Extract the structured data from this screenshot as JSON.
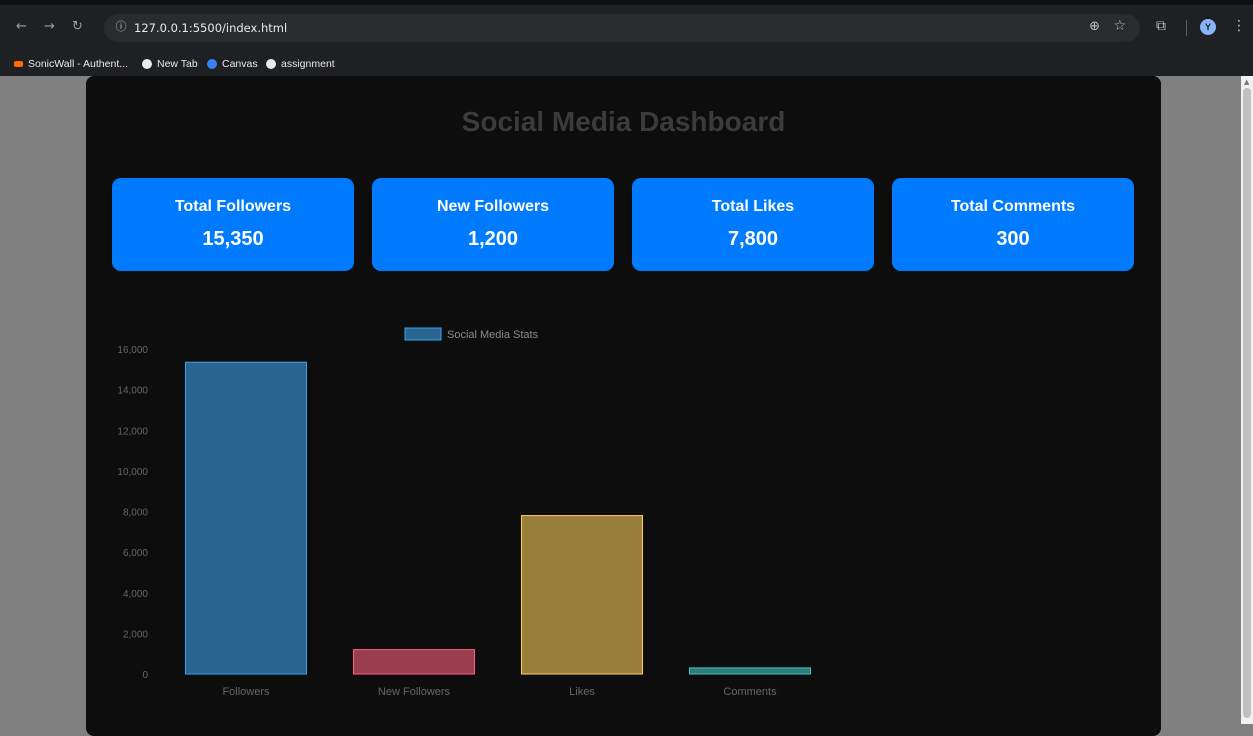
{
  "browser": {
    "url": "127.0.0.1:5500/index.html",
    "avatar_letter": "Y",
    "bookmarks": [
      {
        "label": "SonicWall - Authent...",
        "icon": "sonicwall-icon",
        "color": "#ff6a00"
      },
      {
        "label": "New Tab",
        "icon": "globe-icon",
        "color": "#e8eaed"
      },
      {
        "label": "Canvas",
        "icon": "canvas-icon",
        "color": "#3b82f6"
      },
      {
        "label": "assignment",
        "icon": "wordpress-icon",
        "color": "#e8eaed"
      }
    ]
  },
  "page": {
    "title": "Social Media Dashboard",
    "cards": [
      {
        "label": "Total Followers",
        "value": "15,350"
      },
      {
        "label": "New Followers",
        "value": "1,200"
      },
      {
        "label": "Total Likes",
        "value": "7,800"
      },
      {
        "label": "Total Comments",
        "value": "300"
      }
    ]
  },
  "chart_data": {
    "type": "bar",
    "categories": [
      "Followers",
      "New Followers",
      "Likes",
      "Comments"
    ],
    "series": [
      {
        "name": "Social Media Stats",
        "values": [
          15350,
          1200,
          7800,
          300
        ]
      }
    ],
    "ylim": [
      0,
      16000
    ],
    "yticks": [
      "0",
      "2,000",
      "4,000",
      "6,000",
      "8,000",
      "10,000",
      "12,000",
      "14,000",
      "16,000"
    ],
    "bar_fills": [
      "#2a6592",
      "#9a3d4e",
      "#9a7f3b",
      "#2a7c7a"
    ],
    "bar_strokes": [
      "#36a2eb",
      "#ff6384",
      "#ffce56",
      "#4bc0c0"
    ],
    "legend_position": "top",
    "grid": false
  }
}
